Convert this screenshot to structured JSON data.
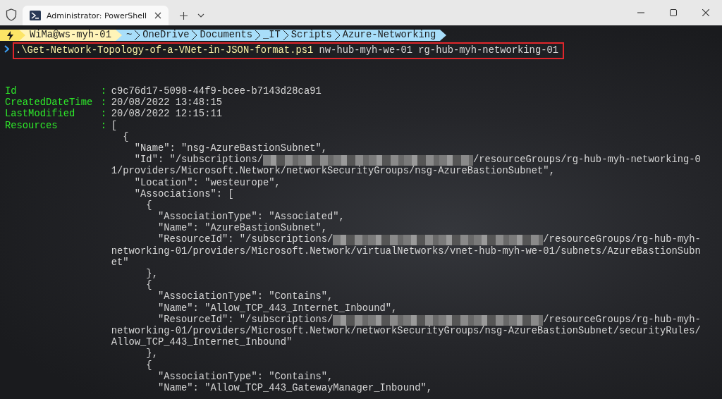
{
  "window": {
    "tab": {
      "title": "Administrator: PowerShell",
      "selected": true
    }
  },
  "prompt": {
    "user": "WiMa@ws-myh-01",
    "path": [
      "~",
      "OneDrive",
      "Documents",
      "_IT",
      "Scripts",
      "Azure-Networking"
    ]
  },
  "command": {
    "script": ".\\Get-Network-Topology-of-a-VNet-in-JSON-format.ps1",
    "args": "nw-hub-myh-we-01 rg-hub-myh-networking-01"
  },
  "output": [
    {
      "key": "Id",
      "sep": ":",
      "segments": [
        {
          "kind": "text",
          "text": "c9c76d17-5098-44f9-bcee-b7143d28ca91"
        }
      ]
    },
    {
      "key": "CreatedDateTime",
      "sep": ":",
      "segments": [
        {
          "kind": "text",
          "text": "20/08/2022 13:48:15"
        }
      ]
    },
    {
      "key": "LastModified",
      "sep": ":",
      "segments": [
        {
          "kind": "text",
          "text": "20/08/2022 12:15:11"
        }
      ]
    },
    {
      "key": "Resources",
      "sep": ":",
      "segments": [
        {
          "kind": "text",
          "text": "["
        }
      ]
    },
    {
      "segments": [
        {
          "kind": "text",
          "text": "  {"
        }
      ]
    },
    {
      "segments": [
        {
          "kind": "text",
          "text": "    \"Name\": \"nsg-AzureBastionSubnet\","
        }
      ]
    },
    {
      "segments": [
        {
          "kind": "text",
          "text": "    \"Id\": \"/subscriptions/"
        },
        {
          "kind": "redacted"
        },
        {
          "kind": "text",
          "text": "/resourceGroups/rg-hub-myh-networking-0"
        }
      ]
    },
    {
      "segments": [
        {
          "kind": "text",
          "text": "1/providers/Microsoft.Network/networkSecurityGroups/nsg-AzureBastionSubnet\","
        }
      ]
    },
    {
      "segments": [
        {
          "kind": "text",
          "text": "    \"Location\": \"westeurope\","
        }
      ]
    },
    {
      "segments": [
        {
          "kind": "text",
          "text": "    \"Associations\": ["
        }
      ]
    },
    {
      "segments": [
        {
          "kind": "text",
          "text": "      {"
        }
      ]
    },
    {
      "segments": [
        {
          "kind": "text",
          "text": "        \"AssociationType\": \"Associated\","
        }
      ]
    },
    {
      "segments": [
        {
          "kind": "text",
          "text": "        \"Name\": \"AzureBastionSubnet\","
        }
      ]
    },
    {
      "segments": [
        {
          "kind": "text",
          "text": "        \"ResourceId\": \"/subscriptions/"
        },
        {
          "kind": "redacted"
        },
        {
          "kind": "text",
          "text": "/resourceGroups/rg-hub-myh-"
        }
      ]
    },
    {
      "segments": [
        {
          "kind": "text",
          "text": "networking-01/providers/Microsoft.Network/virtualNetworks/vnet-hub-myh-we-01/subnets/AzureBastionSubn"
        }
      ]
    },
    {
      "segments": [
        {
          "kind": "text",
          "text": "et\""
        }
      ]
    },
    {
      "segments": [
        {
          "kind": "text",
          "text": "      },"
        }
      ]
    },
    {
      "segments": [
        {
          "kind": "text",
          "text": "      {"
        }
      ]
    },
    {
      "segments": [
        {
          "kind": "text",
          "text": "        \"AssociationType\": \"Contains\","
        }
      ]
    },
    {
      "segments": [
        {
          "kind": "text",
          "text": "        \"Name\": \"Allow_TCP_443_Internet_Inbound\","
        }
      ]
    },
    {
      "segments": [
        {
          "kind": "text",
          "text": "        \"ResourceId\": \"/subscriptions/"
        },
        {
          "kind": "redacted"
        },
        {
          "kind": "text",
          "text": "/resourceGroups/rg-hub-myh-"
        }
      ]
    },
    {
      "segments": [
        {
          "kind": "text",
          "text": "networking-01/providers/Microsoft.Network/networkSecurityGroups/nsg-AzureBastionSubnet/securityRules/"
        }
      ]
    },
    {
      "segments": [
        {
          "kind": "text",
          "text": "Allow_TCP_443_Internet_Inbound\""
        }
      ]
    },
    {
      "segments": [
        {
          "kind": "text",
          "text": "      },"
        }
      ]
    },
    {
      "segments": [
        {
          "kind": "text",
          "text": "      {"
        }
      ]
    },
    {
      "segments": [
        {
          "kind": "text",
          "text": "        \"AssociationType\": \"Contains\","
        }
      ]
    },
    {
      "segments": [
        {
          "kind": "text",
          "text": "        \"Name\": \"Allow_TCP_443_GatewayManager_Inbound\","
        }
      ]
    }
  ]
}
